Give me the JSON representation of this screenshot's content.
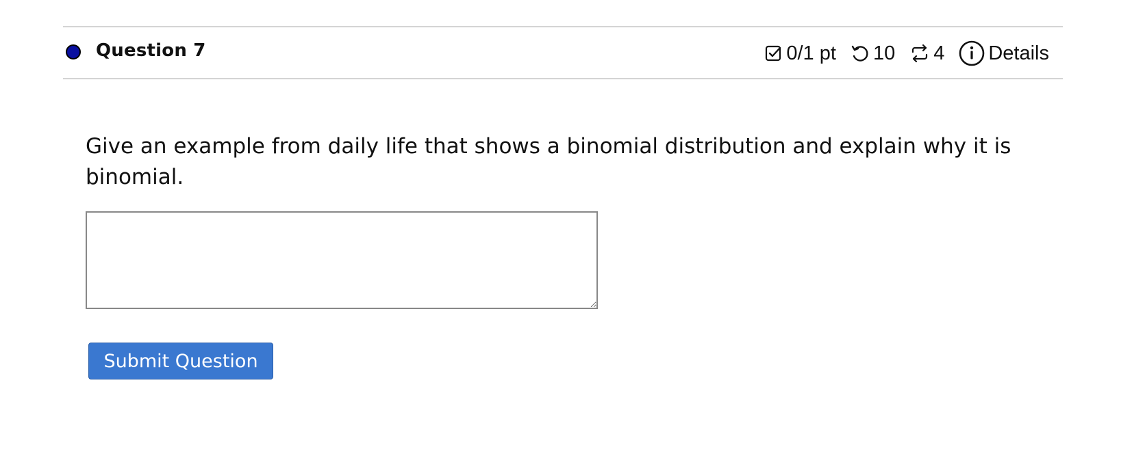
{
  "question": {
    "title": "Question 7",
    "status_dot_color": "#0a10a0",
    "meta": {
      "points": "0/1 pt",
      "retries": "10",
      "attempts": "4",
      "details_label": "Details",
      "icons": [
        "checkbox-icon",
        "retry-icon",
        "attempts-icon",
        "info-icon"
      ]
    },
    "prompt": "Give an example from daily life that shows a binomial distribution and explain why it is binomial.",
    "answer": {
      "value": "",
      "placeholder": ""
    },
    "submit_label": "Submit Question",
    "accent_color": "#3a78d0"
  }
}
